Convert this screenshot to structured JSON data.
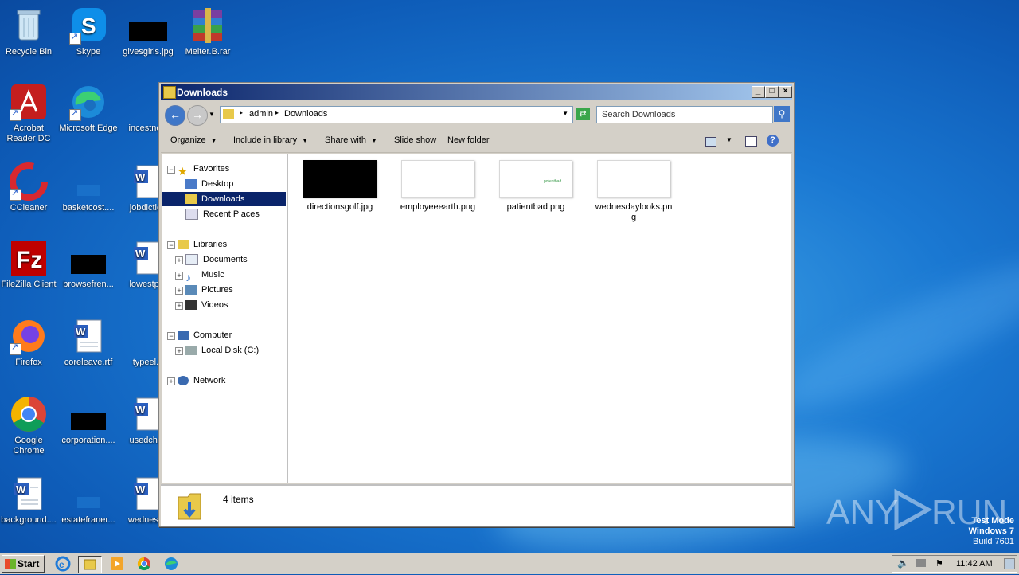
{
  "desktop": {
    "icons": [
      {
        "label": "Recycle Bin",
        "icon": "recycle-bin-icon"
      },
      {
        "label": "Skype",
        "icon": "skype-icon"
      },
      {
        "label": "givesgirls.jpg",
        "icon": "image-file-icon"
      },
      {
        "label": "Melter.B.rar",
        "icon": "winrar-icon"
      },
      {
        "label": "Acrobat Reader DC",
        "icon": "acrobat-icon"
      },
      {
        "label": "Microsoft Edge",
        "icon": "edge-icon"
      },
      {
        "label": "incestnew",
        "icon": "word-doc-icon"
      },
      {
        "label": "CCleaner",
        "icon": "ccleaner-icon"
      },
      {
        "label": "basketcost....",
        "icon": "blank-file-icon"
      },
      {
        "label": "jobdiction",
        "icon": "word-doc-icon"
      },
      {
        "label": "FileZilla Client",
        "icon": "filezilla-icon"
      },
      {
        "label": "browsefren...",
        "icon": "image-file-icon"
      },
      {
        "label": "lowestper",
        "icon": "word-doc-icon"
      },
      {
        "label": "Firefox",
        "icon": "firefox-icon"
      },
      {
        "label": "coreleave.rtf",
        "icon": "word-doc-icon"
      },
      {
        "label": "typeel.p",
        "icon": "blank-file-icon"
      },
      {
        "label": "Google Chrome",
        "icon": "chrome-icon"
      },
      {
        "label": "corporation....",
        "icon": "image-file-icon"
      },
      {
        "label": "usedchris",
        "icon": "word-doc-icon"
      },
      {
        "label": "background....",
        "icon": "word-doc-icon"
      },
      {
        "label": "estatefraner...",
        "icon": "blank-file-icon"
      },
      {
        "label": "wednesda",
        "icon": "word-doc-icon"
      }
    ],
    "watermark": {
      "brand": "ANY RUN",
      "line1": "Test Mode",
      "line2": "Windows 7",
      "line3": "Build 7601"
    }
  },
  "window": {
    "title": "Downloads",
    "breadcrumb": [
      "admin",
      "Downloads"
    ],
    "search_placeholder": "Search Downloads",
    "commands": [
      "Organize",
      "Include in library",
      "Share with",
      "Slide show",
      "New folder"
    ],
    "nav": {
      "favorites_header": "Favorites",
      "favorites": [
        "Desktop",
        "Downloads",
        "Recent Places"
      ],
      "libraries_header": "Libraries",
      "libraries": [
        "Documents",
        "Music",
        "Pictures",
        "Videos"
      ],
      "computer_header": "Computer",
      "computer": [
        "Local Disk (C:)"
      ],
      "network_header": "Network"
    },
    "files": [
      {
        "name": "directionsgolf.jpg",
        "thumb": "black"
      },
      {
        "name": "employeeearth.png",
        "thumb": "white"
      },
      {
        "name": "patientbad.png",
        "thumb": "white-green-text",
        "thumb_text": "potentbad"
      },
      {
        "name": "wednesdaylooks.png",
        "thumb": "white"
      }
    ],
    "status": "4 items"
  },
  "taskbar": {
    "start_label": "Start",
    "clock": "11:42 AM"
  }
}
